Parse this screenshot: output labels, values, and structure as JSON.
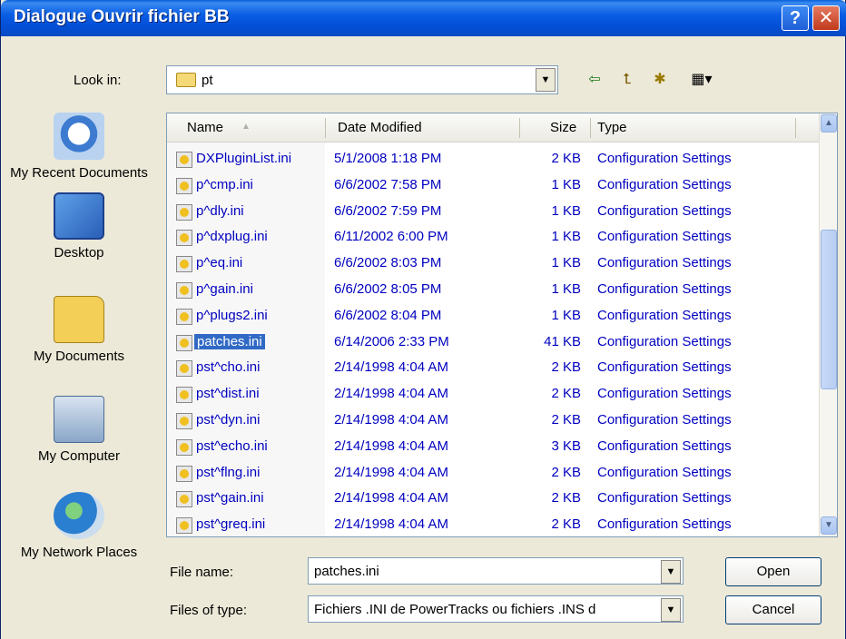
{
  "window": {
    "title": "Dialogue Ouvrir fichier BB",
    "help_glyph": "?",
    "close_glyph": "✕"
  },
  "lookin": {
    "label": "Look in:",
    "value": "pt"
  },
  "toolbar": {
    "back_icon": "⇦",
    "up_icon": "⮤",
    "newfolder_icon": "✱",
    "views_icon": "▦▾"
  },
  "places": [
    {
      "label": "My Recent Documents"
    },
    {
      "label": "Desktop"
    },
    {
      "label": "My Documents"
    },
    {
      "label": "My Computer"
    },
    {
      "label": "My Network Places"
    }
  ],
  "columns": {
    "name": "Name",
    "date": "Date Modified",
    "size": "Size",
    "type": "Type"
  },
  "files": [
    {
      "name": "DXPluginList.ini",
      "date": "5/1/2008 1:18 PM",
      "size": "2 KB",
      "type": "Configuration Settings"
    },
    {
      "name": "p^cmp.ini",
      "date": "6/6/2002 7:58 PM",
      "size": "1 KB",
      "type": "Configuration Settings"
    },
    {
      "name": "p^dly.ini",
      "date": "6/6/2002 7:59 PM",
      "size": "1 KB",
      "type": "Configuration Settings"
    },
    {
      "name": "p^dxplug.ini",
      "date": "6/11/2002 6:00 PM",
      "size": "1 KB",
      "type": "Configuration Settings"
    },
    {
      "name": "p^eq.ini",
      "date": "6/6/2002 8:03 PM",
      "size": "1 KB",
      "type": "Configuration Settings"
    },
    {
      "name": "p^gain.ini",
      "date": "6/6/2002 8:05 PM",
      "size": "1 KB",
      "type": "Configuration Settings"
    },
    {
      "name": "p^plugs2.ini",
      "date": "6/6/2002 8:04 PM",
      "size": "1 KB",
      "type": "Configuration Settings"
    },
    {
      "name": "patches.ini",
      "date": "6/14/2006 2:33 PM",
      "size": "41 KB",
      "type": "Configuration Settings",
      "selected": true
    },
    {
      "name": "pst^cho.ini",
      "date": "2/14/1998 4:04 AM",
      "size": "2 KB",
      "type": "Configuration Settings"
    },
    {
      "name": "pst^dist.ini",
      "date": "2/14/1998 4:04 AM",
      "size": "2 KB",
      "type": "Configuration Settings"
    },
    {
      "name": "pst^dyn.ini",
      "date": "2/14/1998 4:04 AM",
      "size": "2 KB",
      "type": "Configuration Settings"
    },
    {
      "name": "pst^echo.ini",
      "date": "2/14/1998 4:04 AM",
      "size": "3 KB",
      "type": "Configuration Settings"
    },
    {
      "name": "pst^flng.ini",
      "date": "2/14/1998 4:04 AM",
      "size": "2 KB",
      "type": "Configuration Settings"
    },
    {
      "name": "pst^gain.ini",
      "date": "2/14/1998 4:04 AM",
      "size": "2 KB",
      "type": "Configuration Settings"
    },
    {
      "name": "pst^greq.ini",
      "date": "2/14/1998 4:04 AM",
      "size": "2 KB",
      "type": "Configuration Settings"
    }
  ],
  "filename": {
    "label": "File name:",
    "value": "patches.ini"
  },
  "filetype": {
    "label": "Files of type:",
    "value": "Fichiers .INI de PowerTracks ou fichiers .INS d"
  },
  "buttons": {
    "open": "Open",
    "cancel": "Cancel"
  },
  "glyphs": {
    "dropdown": "▼",
    "sort_up": "▲",
    "scroll_up": "▲",
    "scroll_down": "▼"
  }
}
